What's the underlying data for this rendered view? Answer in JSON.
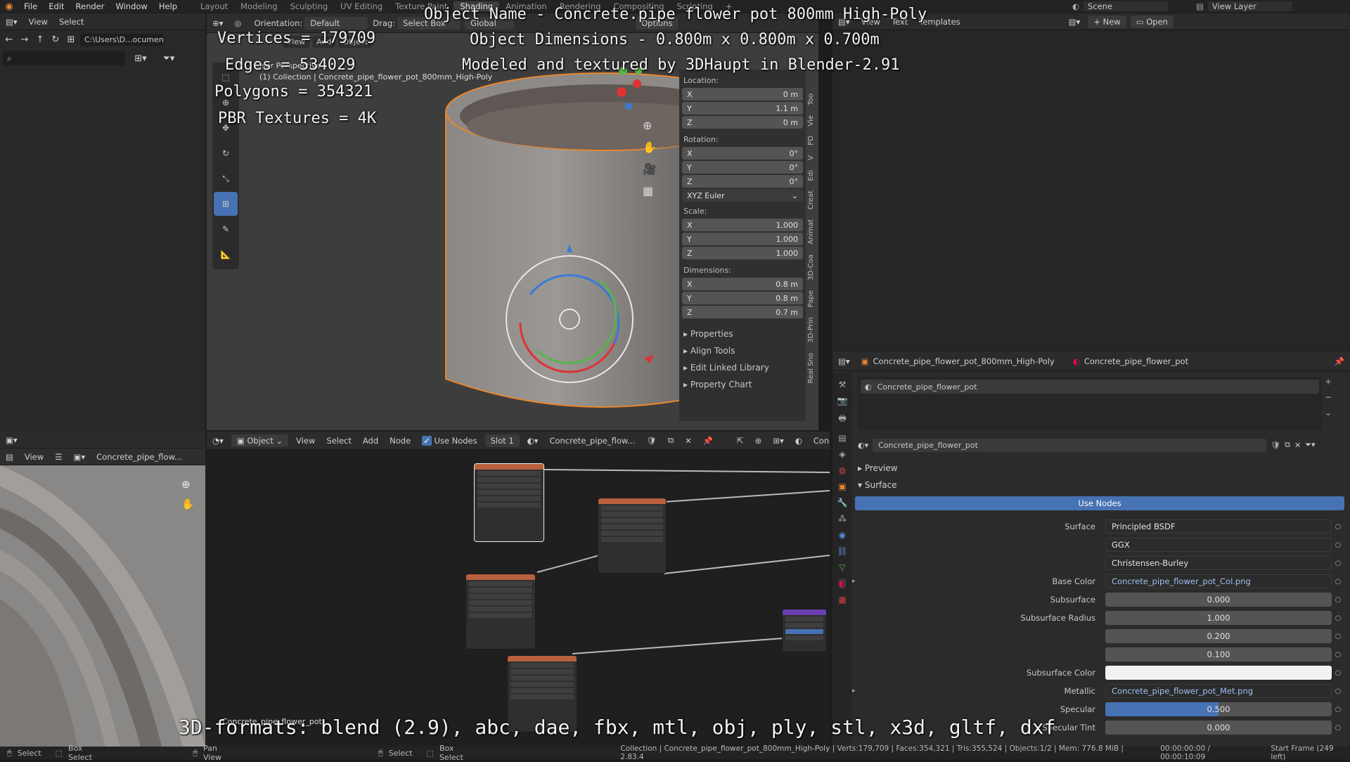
{
  "app": {
    "menus": [
      "File",
      "Edit",
      "Render",
      "Window",
      "Help"
    ],
    "workspaces": [
      "Layout",
      "Modeling",
      "Sculpting",
      "UV Editing",
      "Texture Paint",
      "Shading",
      "Animation",
      "Rendering",
      "Compositing",
      "Scripting"
    ],
    "active_workspace": "Shading",
    "scene": "Scene",
    "view_layer": "View Layer"
  },
  "file_browser": {
    "menus": [
      "View",
      "Select"
    ],
    "path": "C:\\Users\\D...ocuments\\"
  },
  "viewport": {
    "orientation_label": "Orientation:",
    "orientation": "Default",
    "drag_label": "Drag:",
    "drag": "Select Box",
    "transform": "Global",
    "options": "Options",
    "menus": [
      "View",
      "Add",
      "Object"
    ],
    "view_name": "User Perspective",
    "collection_line": "(1) Collection | Concrete_pipe_flower_pot_800mm_High-Poly"
  },
  "overlay": {
    "line1": "Object Name - Concrete.pipe flower pot 800mm High-Poly",
    "line2": "Object Dimensions - 0.800m x 0.800m x 0.700m",
    "line3": "Modeled and textured by 3DHaupt in Blender-2.91",
    "vertices": "Vertices = 179709",
    "edges": "Edges = 534029",
    "polygons": "Polygons = 354321",
    "pbr": "PBR Textures = 4K",
    "formats": "3D-formats: blend (2.9), abc, dae, fbx, mtl, obj, ply, stl, x3d, gltf, dxf"
  },
  "npanel": {
    "location_label": "Location:",
    "location": {
      "x": "0 m",
      "y": "1.1 m",
      "z": "0 m"
    },
    "rotation_label": "Rotation:",
    "rotation": {
      "x": "0°",
      "y": "0°",
      "z": "0°"
    },
    "rotation_mode": "XYZ Euler",
    "scale_label": "Scale:",
    "scale": {
      "x": "1.000",
      "y": "1.000",
      "z": "1.000"
    },
    "dimensions_label": "Dimensions:",
    "dimensions": {
      "x": "0.8 m",
      "y": "0.8 m",
      "z": "0.7 m"
    },
    "axis": {
      "x": "X",
      "y": "Y",
      "z": "Z"
    },
    "sections": [
      "Properties",
      "Align Tools",
      "Edit Linked Library",
      "Property Chart"
    ],
    "tabs": [
      "Too",
      "Vie",
      "PD",
      "V",
      "Edi",
      "Creat",
      "Animat",
      "3D-Coa",
      "Pape",
      "3D-Prin",
      "Real Sno"
    ]
  },
  "text_editor": {
    "menus": [
      "View",
      "Text"
    ],
    "templates": "Templates",
    "new": "New",
    "open": "Open"
  },
  "node_editor": {
    "mode": "Object",
    "menus": [
      "View",
      "Select",
      "Add",
      "Node"
    ],
    "use_nodes": "Use Nodes",
    "slot": "Slot 1",
    "material": "Concrete_pipe_flow...",
    "material2": "Concre",
    "footer": "Concrete_pipe_flower_pot"
  },
  "image_editor": {
    "view": "View",
    "image": "Concrete_pipe_flow..."
  },
  "properties": {
    "object": "Concrete_pipe_flower_pot_800mm_High-Poly",
    "material": "Concrete_pipe_flower_pot",
    "slot_item": "Concrete_pipe_flower_pot",
    "material_field": "Concrete_pipe_flower_pot",
    "preview": "Preview",
    "surface_section": "Surface",
    "use_nodes": "Use Nodes",
    "rows": [
      {
        "label": "Surface",
        "value": "Principled BSDF",
        "kind": "dd"
      },
      {
        "label": "",
        "value": "GGX",
        "kind": "dd"
      },
      {
        "label": "",
        "value": "Christensen-Burley",
        "kind": "dd"
      },
      {
        "label": "Base Color",
        "value": "Concrete_pipe_flower_pot_Col.png",
        "kind": "link"
      },
      {
        "label": "Subsurface",
        "value": "0.000",
        "kind": "num"
      },
      {
        "label": "Subsurface Radius",
        "value": "1.000",
        "kind": "num"
      },
      {
        "label": "",
        "value": "0.200",
        "kind": "num"
      },
      {
        "label": "",
        "value": "0.100",
        "kind": "num"
      },
      {
        "label": "Subsurface Color",
        "value": "",
        "kind": "color"
      },
      {
        "label": "Metallic",
        "value": "Concrete_pipe_flower_pot_Met.png",
        "kind": "link"
      },
      {
        "label": "Specular",
        "value": "0.500",
        "kind": "slider"
      },
      {
        "label": "Specular Tint",
        "value": "0.000",
        "kind": "num"
      }
    ]
  },
  "status": {
    "select": "Select",
    "box_select": "Box Select",
    "pan_view": "Pan View",
    "select2": "Select",
    "box_select2": "Box Select",
    "info": "Collection | Concrete_pipe_flower_pot_800mm_High-Poly | Verts:179,709 | Faces:354,321 | Tris:355,524 | Objects:1/2 | Mem: 776.8 MiB | 2.83.4",
    "time": "00:00:00:00 / 00:00:10:09",
    "frames": "Start Frame (249 left)"
  },
  "colors": {
    "accent": "#4772b3",
    "selected_orange": "#e8872d"
  }
}
